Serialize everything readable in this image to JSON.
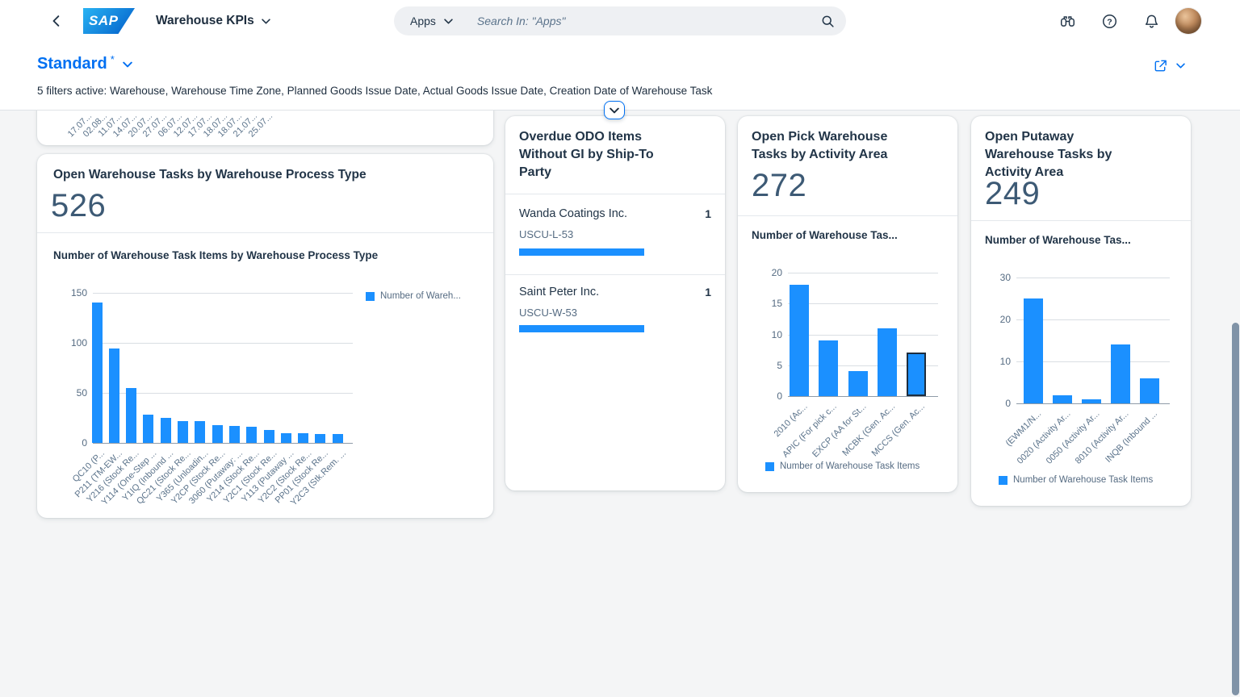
{
  "topbar": {
    "app_title": "Warehouse KPIs",
    "search_scope_label": "Apps",
    "search_placeholder": "Search In: \"Apps\""
  },
  "variant_bar": {
    "variant_title": "Standard",
    "modified_marker": "*",
    "filters_summary": "5 filters active: Warehouse, Warehouse Time Zone, Planned Goods Issue Date, Actual Goods Issue Date, Creation Date of Warehouse Task"
  },
  "icons": [
    "back-icon",
    "sap-logo",
    "chevron-down-icon",
    "search-icon",
    "binoculars-icon",
    "help-icon",
    "bell-icon",
    "avatar",
    "share-icon",
    "expand-header-icon"
  ],
  "colors": {
    "brand_blue": "#0070f2",
    "chart_blue": "#1b90ff",
    "text_dark": "#223548",
    "text_muted": "#556b82"
  },
  "cards": {
    "clipped_chart": {
      "x_labels": [
        "17.07...",
        "02.08...",
        "11.07...",
        "14.07...",
        "20.07...",
        "27.07...",
        "06.07...",
        "12.07...",
        "17.07...",
        "18.07...",
        "18.07...",
        "21.07...",
        "25.07..."
      ]
    },
    "process_type": {
      "title": "Open Warehouse Tasks by Warehouse Process Type",
      "kpi_value": "526",
      "chart_title": "Number of Warehouse Task Items by Warehouse Process Type",
      "legend_label": "Number of Wareh...",
      "chart_data": {
        "type": "bar",
        "categories": [
          "QC10 (P...",
          "P211 (TM-EW...",
          "Y216 (Stock Re...",
          "Y114 (One-Step ...",
          "Y1IQ (Inbound ...",
          "QC21 (Stock Re...",
          "Y365 (Unloadin...",
          "Y2CP (Stock Re...",
          "3060 (Putaway: ...",
          "Y214 (Stock Re...",
          "Y2C1 (Stock Re...",
          "Y113 (Putaway ...",
          "Y2C2 (Stock Re...",
          "PP01 (Stock Re...",
          "Y2C3 (Stk.Rem. ..."
        ],
        "values": [
          140,
          94,
          55,
          28,
          25,
          22,
          22,
          18,
          17,
          16,
          13,
          10,
          10,
          9,
          9
        ],
        "series_name": "Number of Warehouse Task Items",
        "ylim": [
          0,
          150
        ],
        "yticks": [
          0,
          50,
          100,
          150
        ]
      }
    },
    "overdue_odo": {
      "title": "Overdue ODO Items Without GI by Ship-To Party",
      "items": [
        {
          "name": "Wanda Coatings Inc.",
          "party_id": "USCU-L-53",
          "value": "1"
        },
        {
          "name": "Saint Peter Inc.",
          "party_id": "USCU-W-53",
          "value": "1"
        }
      ]
    },
    "open_pick": {
      "title": "Open Pick Warehouse Tasks by Activity Area",
      "kpi_value": "272",
      "chart_title": "Number of Warehouse Tas...",
      "legend_label": "Number of Warehouse Task Items",
      "chart_data": {
        "type": "bar",
        "categories": [
          "2010 (Ac...",
          "APIC (For pick c...",
          "EXCP (AA for St...",
          "MCBK (Gen. Ac...",
          "MCCS (Gen. Ac..."
        ],
        "values": [
          18,
          9,
          4,
          11,
          7
        ],
        "series_name": "Number of Warehouse Task Items",
        "ylim": [
          0,
          20
        ],
        "yticks": [
          0,
          5,
          10,
          15,
          20
        ],
        "selected_index": 4
      }
    },
    "open_putaway": {
      "title": "Open Putaway Warehouse Tasks by Activity Area",
      "kpi_value": "249",
      "chart_title": "Number of Warehouse Tas...",
      "legend_label": "Number of Warehouse Task Items",
      "chart_data": {
        "type": "bar",
        "categories": [
          "(EWM1/N...",
          "0020 (Activity Ar...",
          "0050 (Activity Ar...",
          "8010 (Activity Ar...",
          "INQB (Inbound ..."
        ],
        "values": [
          25,
          2,
          1,
          14,
          6
        ],
        "series_name": "Number of Warehouse Task Items",
        "ylim": [
          0,
          30
        ],
        "yticks": [
          0,
          10,
          20,
          30
        ]
      }
    }
  }
}
